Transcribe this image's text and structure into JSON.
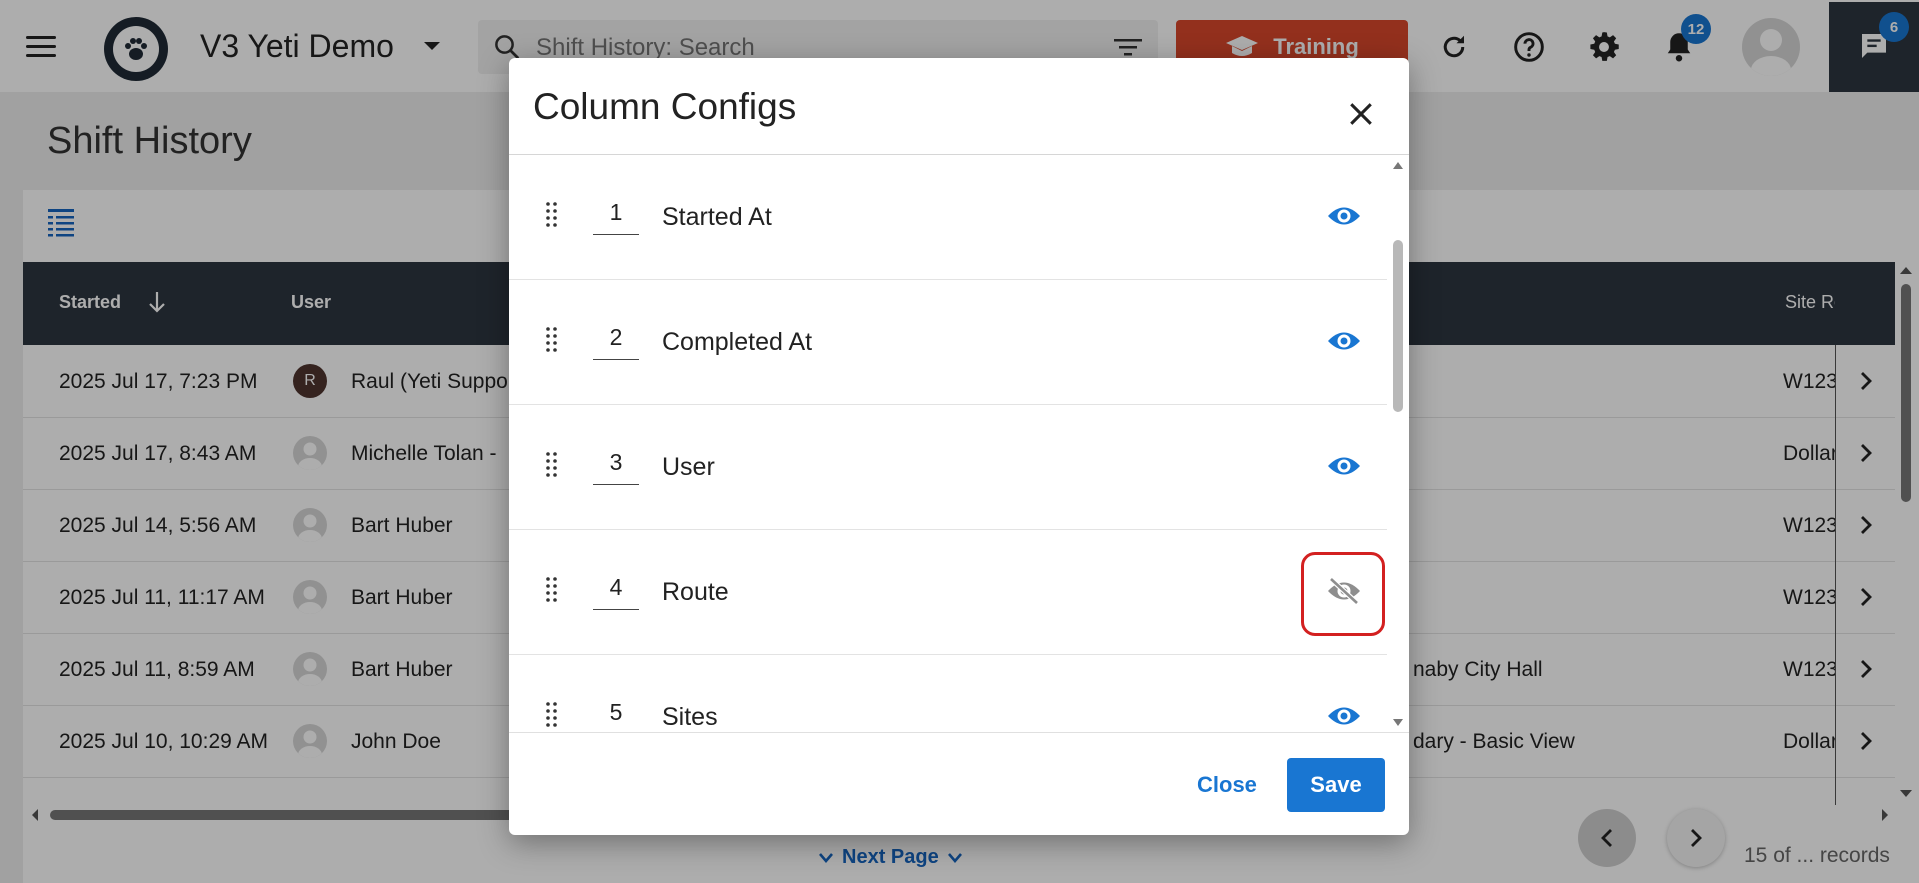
{
  "header": {
    "app_title": "V3 Yeti Demo",
    "search_placeholder": "Shift History: Search",
    "training_label": "Training",
    "notification_count": "12",
    "chat_count": "6"
  },
  "page": {
    "title": "Shift History",
    "columns": {
      "started": "Started",
      "user": "User",
      "site": "Site Re"
    },
    "rows": [
      {
        "started": "2025 Jul 17, 7:23 PM",
        "avatar_letter": "R",
        "user": "Raul (Yeti Suppo",
        "route": "",
        "site": "W123"
      },
      {
        "started": "2025 Jul 17, 8:43 AM",
        "avatar_letter": "",
        "user": "Michelle Tolan -",
        "route": "",
        "site": "Dollar"
      },
      {
        "started": "2025 Jul 14, 5:56 AM",
        "avatar_letter": "",
        "user": "Bart Huber",
        "route": "",
        "site": "W123"
      },
      {
        "started": "2025 Jul 11, 11:17 AM",
        "avatar_letter": "",
        "user": "Bart Huber",
        "route": "",
        "site": "W123"
      },
      {
        "started": "2025 Jul 11, 8:59 AM",
        "avatar_letter": "",
        "user": "Bart Huber",
        "route": "naby City Hall",
        "site": "W123"
      },
      {
        "started": "2025 Jul 10, 10:29 AM",
        "avatar_letter": "",
        "user": "John Doe",
        "route": "dary - Basic View",
        "site": "Dollar"
      }
    ],
    "next_page_label": "Next Page",
    "records_label": "15 of ... records"
  },
  "modal": {
    "title": "Column Configs",
    "items": [
      {
        "index": "1",
        "label": "Started At",
        "visible": true
      },
      {
        "index": "2",
        "label": "Completed At",
        "visible": true
      },
      {
        "index": "3",
        "label": "User",
        "visible": true
      },
      {
        "index": "4",
        "label": "Route",
        "visible": false
      },
      {
        "index": "5",
        "label": "Sites",
        "visible": true
      }
    ],
    "close_label": "Close",
    "save_label": "Save"
  },
  "colors": {
    "primary": "#1976d2",
    "training": "#d9472b",
    "header_dark": "#2d3540",
    "highlight": "#d32020"
  }
}
